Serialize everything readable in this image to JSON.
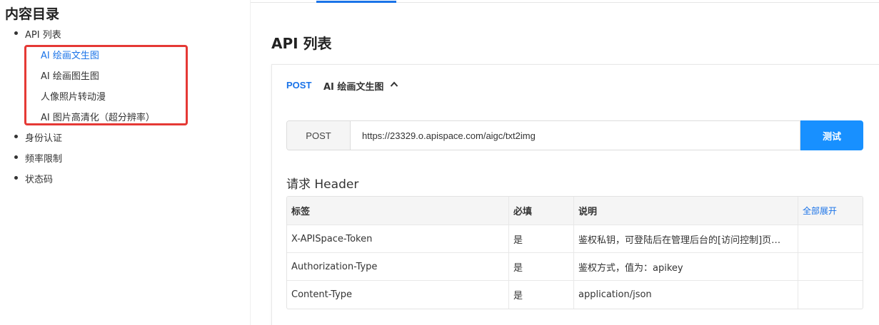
{
  "toc": {
    "title": "内容目录",
    "items": [
      {
        "label": "API 列表"
      },
      {
        "label": "身份认证"
      },
      {
        "label": "频率限制"
      },
      {
        "label": "状态码"
      }
    ],
    "sub_items": [
      {
        "label": "AI 绘画文生图",
        "active": true
      },
      {
        "label": "AI 绘画图生图"
      },
      {
        "label": "人像照片转动漫"
      },
      {
        "label": "AI 图片高清化（超分辨率）"
      }
    ]
  },
  "main": {
    "section_title": "API 列表",
    "endpoint": {
      "method": "POST",
      "name": "AI 绘画文生图",
      "chevron_icon": "chevron-up-icon"
    },
    "request": {
      "method": "POST",
      "url": "https://23329.o.apispace.com/aigc/txt2img",
      "test_button": "测试"
    },
    "header_section": {
      "title": "请求 Header",
      "columns": [
        "标签",
        "必填",
        "说明"
      ],
      "expand_all": "全部展开",
      "rows": [
        {
          "name": "X-APISpace-Token",
          "required": "是",
          "desc": "鉴权私钥，可登陆后在管理后台的[访问控制]页…"
        },
        {
          "name": "Authorization-Type",
          "required": "是",
          "desc": "鉴权方式，值为：apikey"
        },
        {
          "name": "Content-Type",
          "required": "是",
          "desc": "application/json"
        }
      ]
    }
  },
  "colors": {
    "accent": "#1a73e8",
    "button": "#1890ff",
    "highlight": "#e53935"
  }
}
